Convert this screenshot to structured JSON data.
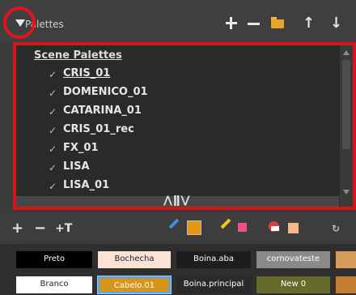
{
  "header": {
    "title": "Palettes",
    "buttons": {
      "add": "+",
      "remove": "−",
      "move_up": "↑",
      "move_down": "↓"
    }
  },
  "palette_list": {
    "section_label": "Scene Palettes",
    "check_glyph": "✓",
    "items": [
      {
        "name": "CRIS_01",
        "current": true
      },
      {
        "name": "DOMENICO_01",
        "current": false
      },
      {
        "name": "CATARINA_01",
        "current": false
      },
      {
        "name": "CRIS_01_rec",
        "current": false
      },
      {
        "name": "FX_01",
        "current": false
      },
      {
        "name": "LISA",
        "current": false
      },
      {
        "name": "LISA_01",
        "current": false
      }
    ],
    "splitter_label": "⋀ǁ⋁"
  },
  "swatch_toolbar": {
    "add": "+",
    "remove": "−",
    "colors": {
      "current_swatch": "#e8950f",
      "pink_swatch": "#f0508a",
      "peach_swatch": "#f3b98a",
      "pen_yellow": "#f5c518",
      "dropper_blue": "#3d8fe0"
    }
  },
  "colors": [
    {
      "name": "Preto",
      "bg": "#000000",
      "fg": "#ffffff"
    },
    {
      "name": "Bochecha",
      "bg": "#fde3d6",
      "fg": "#222222"
    },
    {
      "name": "Boina.aba",
      "bg": "#1d1d1d",
      "fg": "#ffffff"
    },
    {
      "name": "cornovateste",
      "bg": "#8a8a8a",
      "fg": "#ffffff"
    },
    {
      "name": "",
      "bg": "#d79b5a",
      "fg": "#ffffff"
    },
    {
      "name": "Branco",
      "bg": "#ffffff",
      "fg": "#222222"
    },
    {
      "name": "Cabelo.01",
      "bg": "#d7961a",
      "fg": "#ffffff",
      "selected": true
    },
    {
      "name": "Boina.principal",
      "bg": "#2a2a2a",
      "fg": "#ffffff"
    },
    {
      "name": "New 0",
      "bg": "#666b2c",
      "fg": "#ffffff"
    },
    {
      "name": "",
      "bg": "#c47d2f",
      "fg": "#ffffff"
    }
  ]
}
